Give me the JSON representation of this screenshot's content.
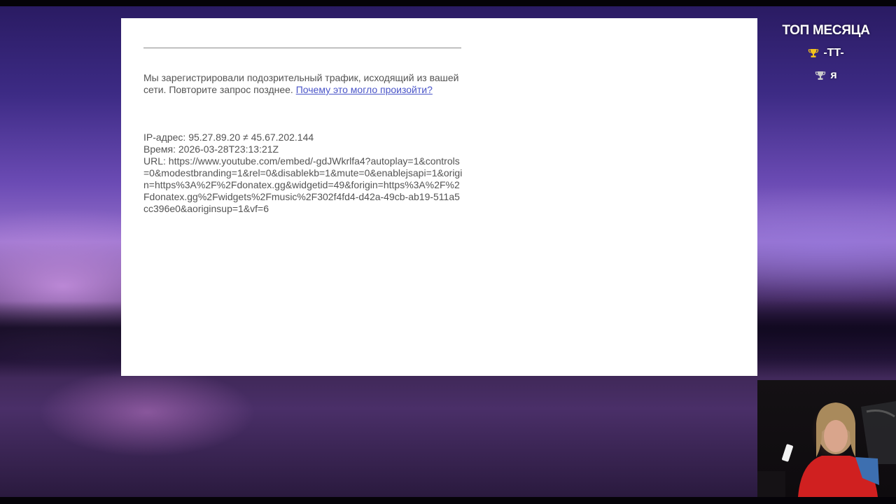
{
  "page": {
    "message_text": "Мы зарегистрировали подозрительный трафик, исходящий из вашей сети. Повторите запрос позднее. ",
    "message_link": "Почему это могло произойти?",
    "ip_line": "IP-адрес: 95.27.89.20 ≠ 45.67.202.144",
    "time_line": "Время: 2026-03-28T23:13:21Z",
    "url_line": "URL: https://www.youtube.com/embed/-gdJWkrlfa4?autoplay=1&controls=0&modestbranding=1&rel=0&disablekb=1&mute=0&enablejsapi=1&origin=https%3A%2F%2Fdonatex.gg&widgetid=49&forigin=https%3A%2F%2Fdonatex.gg%2Fwidgets%2Fmusic%2F302f4fd4-d42a-49cb-ab19-511a5cc396e0&aoriginsup=1&vf=6"
  },
  "overlay": {
    "title": "ТОП МЕСЯЦА",
    "entries": [
      {
        "name": "-TT-",
        "trophy": "gold-trophy-icon",
        "color": "#f2c21c"
      },
      {
        "name": "я",
        "trophy": "silver-trophy-icon",
        "color": "#c9c9c9"
      }
    ]
  },
  "colors": {
    "link": "#4a55c8",
    "text": "#545454"
  }
}
